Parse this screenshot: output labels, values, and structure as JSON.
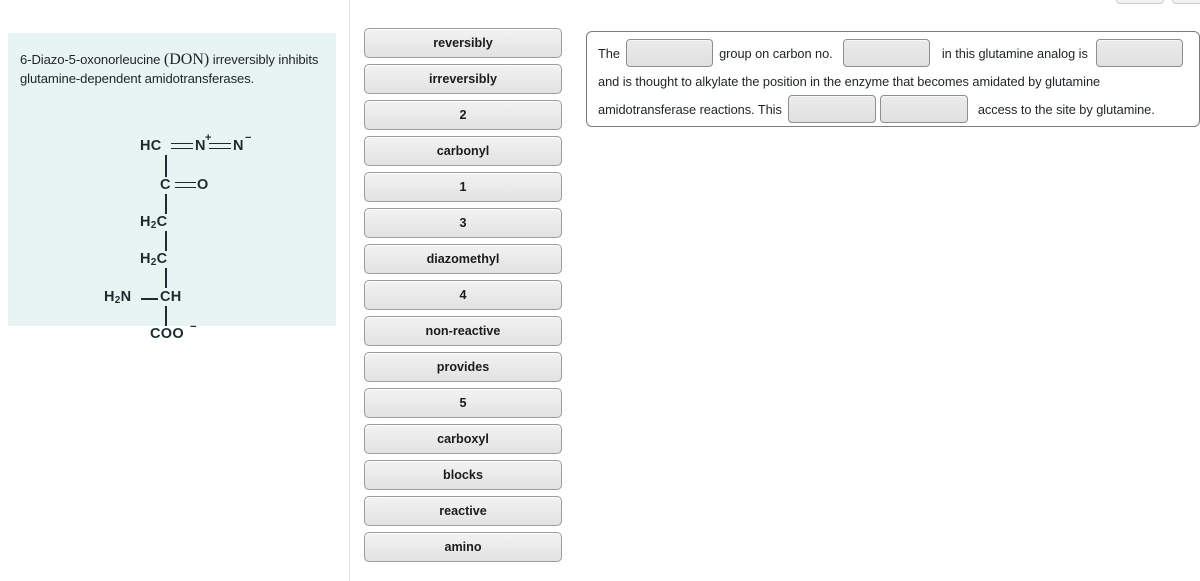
{
  "figure": {
    "caption_part1": "6-Diazo-5-oxonorleucine ",
    "caption_abbrev": "(DON)",
    "caption_part2": " irreversibly inhibits glutamine-dependent amidotransferases.",
    "panel_bg": "#e8f4f2",
    "structure_name": "6-Diazo-5-oxonorleucine (DON)",
    "atoms": {
      "diazo_hc": "HC",
      "diazo_n_plus": "N",
      "diazo_n_plus_charge": "+",
      "diazo_n_minus": "N",
      "diazo_n_minus_charge": "−",
      "carbonyl_c": "C",
      "carbonyl_o": "O",
      "ch2_a": "H",
      "ch2_a_sub": "2",
      "ch2_a_c": "C",
      "ch2_b": "H",
      "ch2_b_sub": "2",
      "ch2_b_c": "C",
      "amine_h": "H",
      "amine_sub": "2",
      "amine_n": "N",
      "alpha_ch": "CH",
      "carboxylate": "COO",
      "carboxylate_charge": "−"
    }
  },
  "word_bank": {
    "items": [
      {
        "label": "reversibly",
        "type": "word"
      },
      {
        "label": "irreversibly",
        "type": "word"
      },
      {
        "label": "2",
        "type": "number"
      },
      {
        "label": "carbonyl",
        "type": "word"
      },
      {
        "label": "1",
        "type": "number"
      },
      {
        "label": "3",
        "type": "number"
      },
      {
        "label": "diazomethyl",
        "type": "word"
      },
      {
        "label": "4",
        "type": "number"
      },
      {
        "label": "non-reactive",
        "type": "word"
      },
      {
        "label": "provides",
        "type": "word"
      },
      {
        "label": "5",
        "type": "number"
      },
      {
        "label": "carboxyl",
        "type": "word"
      },
      {
        "label": "blocks",
        "type": "word"
      },
      {
        "label": "reactive",
        "type": "word"
      },
      {
        "label": "amino",
        "type": "word"
      }
    ]
  },
  "sentence": {
    "line1": {
      "seg1": "The",
      "seg2": "group on carbon no.",
      "seg3": "in this glutamine analog is"
    },
    "line2": {
      "seg1": "and is thought to alkylate the position in the enzyme that becomes amidated by glutamine"
    },
    "line3": {
      "seg1": "amidotransferase reactions. This",
      "seg2": "access to the site by glutamine."
    },
    "slots": [
      {
        "id": "slot-1",
        "value": ""
      },
      {
        "id": "slot-2",
        "value": ""
      },
      {
        "id": "slot-3",
        "value": ""
      },
      {
        "id": "slot-4",
        "value": ""
      },
      {
        "id": "slot-5",
        "value": ""
      }
    ]
  },
  "colors": {
    "panel_teal": "#e8f4f2",
    "chip_face": "#eaeaea",
    "chip_border": "#9a9d9f",
    "text": "#1d2326",
    "divider": "#e3e4e6"
  }
}
